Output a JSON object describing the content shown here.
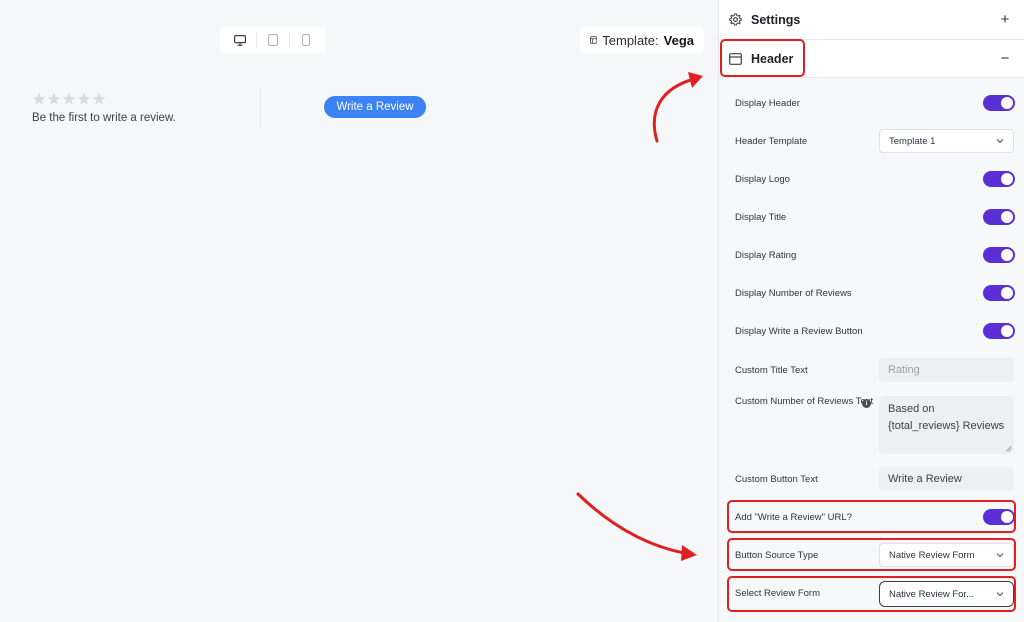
{
  "preview": {
    "template_label": "Template:",
    "template_value": "Vega",
    "first_review_text": "Be the first to write a review.",
    "write_review_button": "Write a Review",
    "star_count": 5
  },
  "panel": {
    "settings_title": "Settings",
    "header_title": "Header",
    "rows": {
      "display_header": "Display Header",
      "header_template": "Header Template",
      "header_template_value": "Template 1",
      "display_logo": "Display Logo",
      "display_title": "Display Title",
      "display_rating": "Display Rating",
      "display_number_reviews": "Display Number of Reviews",
      "display_write_review_button": "Display Write a Review Button",
      "custom_title_text": "Custom Title Text",
      "custom_title_placeholder": "Rating",
      "custom_number_label": "Custom Number of Reviews Text",
      "custom_number_value": "Based on {total_reviews} Reviews",
      "custom_button_text": "Custom Button Text",
      "custom_button_value": "Write a Review",
      "add_url": "Add \"Write a Review\" URL?",
      "button_source_type": "Button Source Type",
      "button_source_value": "Native Review Form",
      "select_review_form": "Select Review Form",
      "select_review_form_value": "Native Review For..."
    }
  },
  "colors": {
    "toggle_on": "#5b2fd6",
    "button_blue": "#3b82f6",
    "annotation_red": "#e02020"
  }
}
